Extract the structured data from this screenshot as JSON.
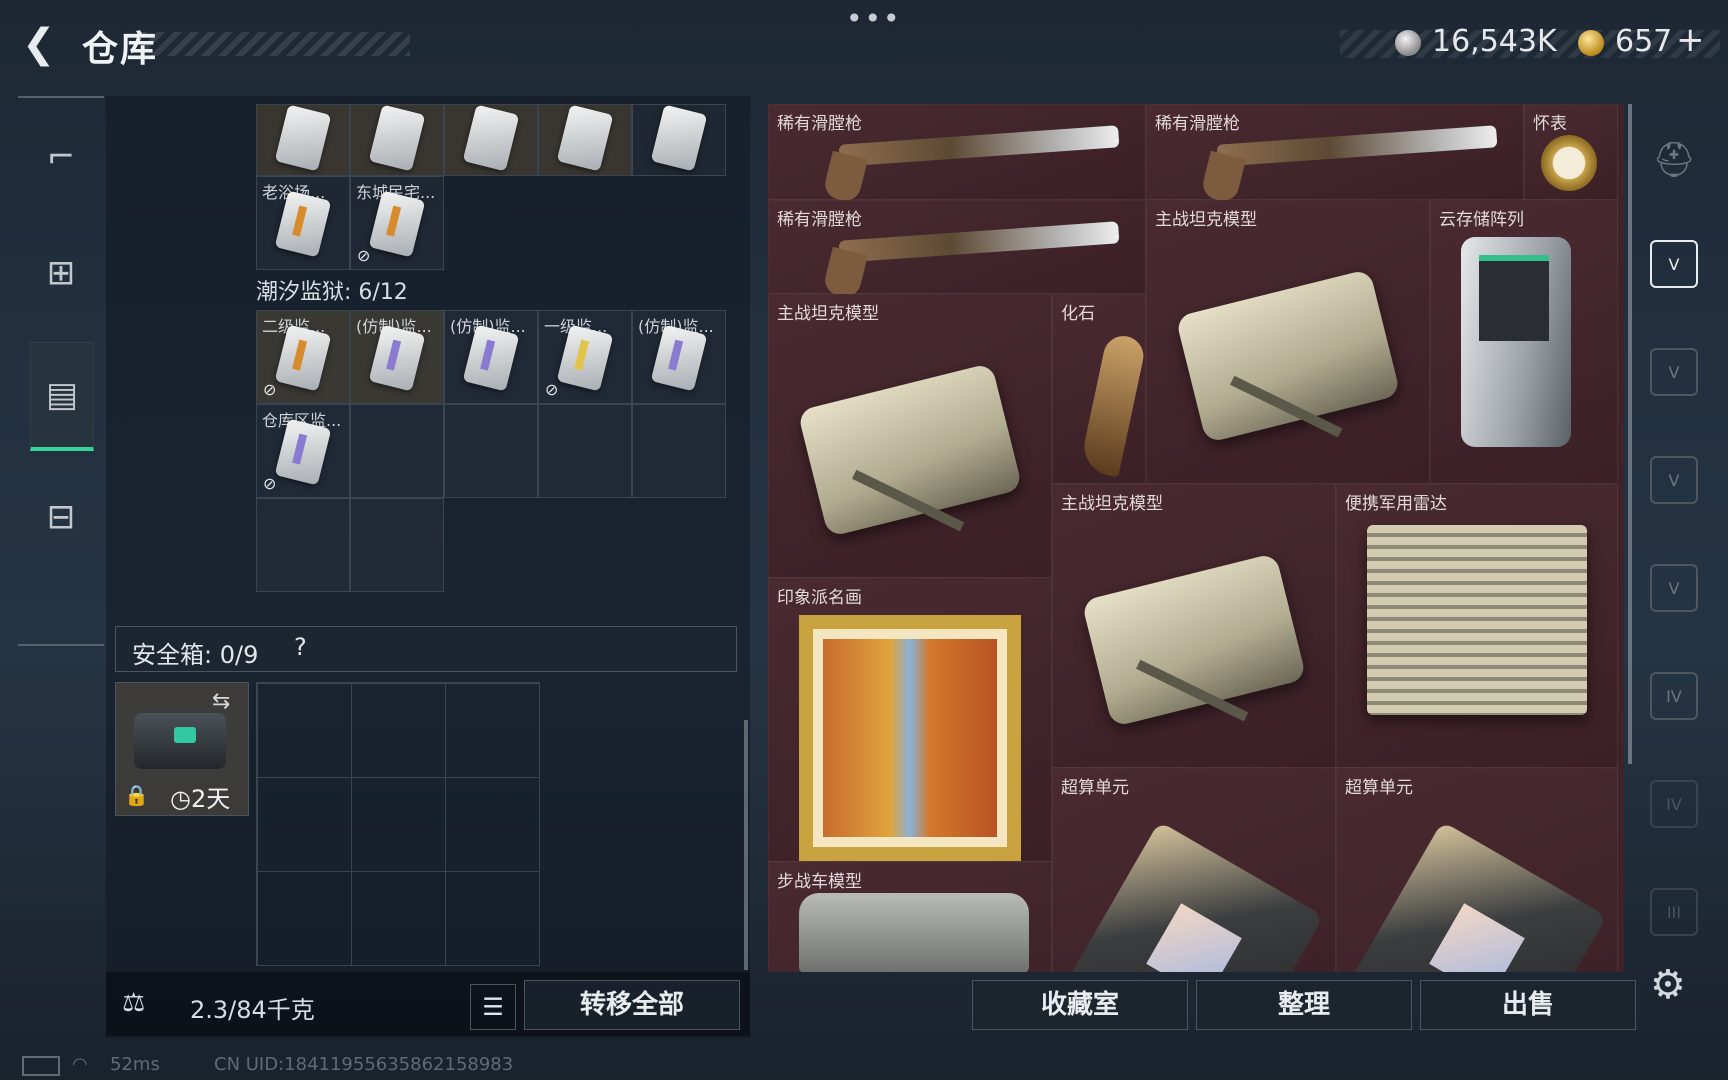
{
  "header": {
    "back_label": "❮",
    "title": "仓库",
    "menu_dots": "•••",
    "currency_silver": "16,543K",
    "currency_gold": "657",
    "add_label": "+"
  },
  "left_nav": {
    "items": [
      {
        "icon": "gun-icon",
        "glyph": "⌐"
      },
      {
        "icon": "backpack-icon",
        "glyph": "⊞"
      },
      {
        "icon": "vest-icon",
        "glyph": "▤",
        "active": true
      },
      {
        "icon": "briefcase-icon",
        "glyph": "⊟"
      }
    ]
  },
  "inventory": {
    "top_row_cells": 5,
    "keys_row": [
      {
        "label": "老浴场...",
        "no_share": false
      },
      {
        "label": "东城民宅...",
        "no_share": true
      }
    ],
    "section_title": "潮汐监狱: 6/12",
    "prison_row1": [
      {
        "label": "二级监...",
        "color": "orange",
        "no_share": true
      },
      {
        "label": "(仿制)监...",
        "color": "purple",
        "no_share": false
      },
      {
        "label": "(仿制)监...",
        "color": "purple",
        "no_share": false
      },
      {
        "label": "一级监...",
        "color": "yellow",
        "no_share": true
      },
      {
        "label": "(仿制)监...",
        "color": "purple",
        "no_share": false
      }
    ],
    "prison_row2": [
      {
        "label": "仓库区监...",
        "color": "purple",
        "no_share": true
      }
    ]
  },
  "safebox": {
    "header": "安全箱: 0/9",
    "help": "?",
    "swap_glyph": "⇆",
    "lock_glyph": "🔒",
    "time_left": "◷2天"
  },
  "bottom_left": {
    "weight_icon_glyph": "⚖",
    "weight": "2.3/84千克",
    "list_glyph": "☰",
    "transfer_all": "转移全部"
  },
  "stash_items": [
    {
      "name": "稀有滑膛枪",
      "kind": "musket"
    },
    {
      "name": "稀有滑膛枪",
      "kind": "musket"
    },
    {
      "name": "怀表",
      "kind": "watch"
    },
    {
      "name": "稀有滑膛枪",
      "kind": "musket"
    },
    {
      "name": "主战坦克模型",
      "kind": "tank"
    },
    {
      "name": "云存储阵列",
      "kind": "server"
    },
    {
      "name": "主战坦克模型",
      "kind": "tank"
    },
    {
      "name": "化石",
      "kind": "claw"
    },
    {
      "name": "主战坦克模型",
      "kind": "tank"
    },
    {
      "name": "便携军用雷达",
      "kind": "radar"
    },
    {
      "name": "印象派名画",
      "kind": "painting"
    },
    {
      "name": "超算单元",
      "kind": "chip"
    },
    {
      "name": "超算单元",
      "kind": "chip"
    },
    {
      "name": "步战车模型",
      "kind": "ifv"
    }
  ],
  "right_tabs": [
    {
      "icon": "helmet-icon",
      "label": "⛑"
    },
    {
      "icon": "stash-v-icon",
      "label": "V",
      "active": true
    },
    {
      "icon": "stash-v-icon",
      "label": "V"
    },
    {
      "icon": "stash-v-icon",
      "label": "V"
    },
    {
      "icon": "stash-v-icon",
      "label": "V"
    },
    {
      "icon": "stash-iv-icon",
      "label": "IV"
    },
    {
      "icon": "stash-iv-icon",
      "label": "IV"
    },
    {
      "icon": "stash-iii-icon",
      "label": "III"
    }
  ],
  "bottom_right": {
    "collection_room": "收藏室",
    "sort": "整理",
    "sell": "出售",
    "gear_glyph": "⚙"
  },
  "status": {
    "wifi_glyph": "◠",
    "ping": "52ms",
    "uid": "CN UID:18411955635862158983"
  },
  "colors": {
    "accent_green": "#35d59a",
    "stash_bg": "#3f2328"
  }
}
